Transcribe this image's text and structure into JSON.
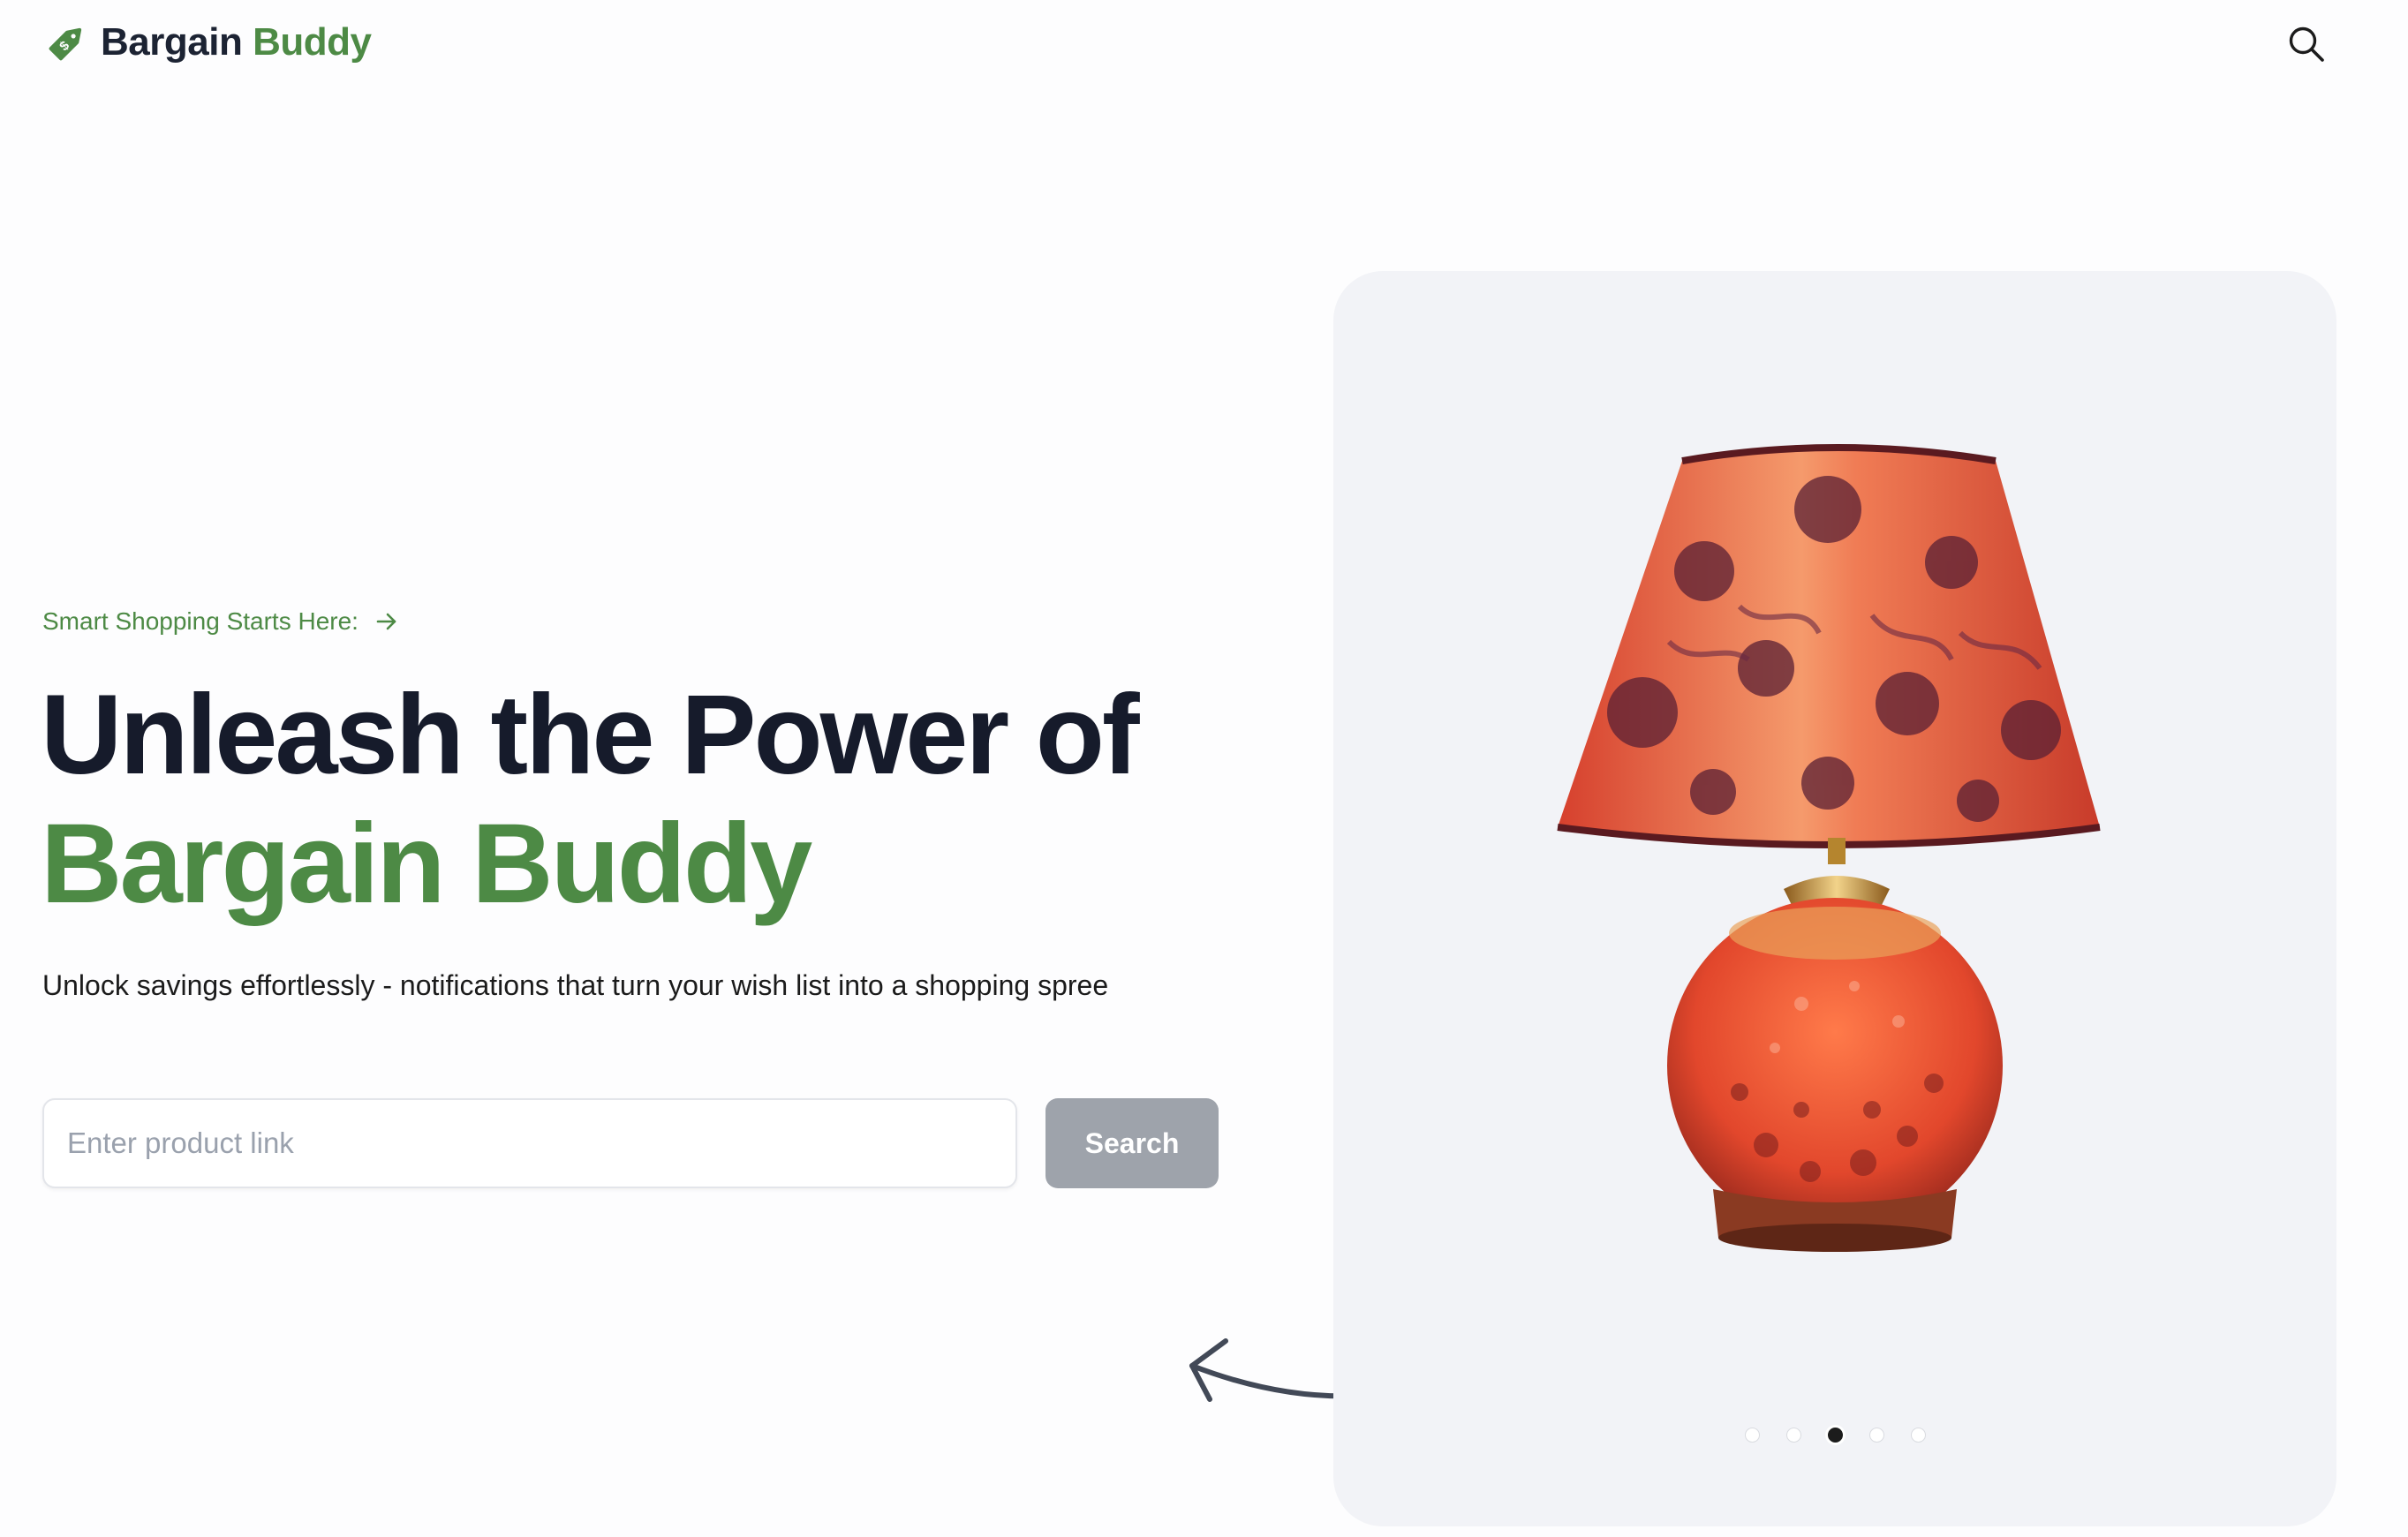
{
  "header": {
    "brand_first": "Bargain",
    "brand_second": "Buddy",
    "logo_icon": "price-tag-icon",
    "search_icon": "search-icon"
  },
  "hero": {
    "tagline": "Smart Shopping Starts Here:",
    "tagline_icon": "arrow-right-icon",
    "headline_line1": "Unleash the Power of",
    "headline_line2": "Bargain Buddy",
    "subtitle": "Unlock savings effortlessly - notifications that turn your wish list into a shopping spree",
    "search": {
      "placeholder": "Enter product link",
      "value": "",
      "button_label": "Search",
      "button_state": "disabled"
    }
  },
  "carousel": {
    "image": "table-lamp",
    "slide_count": 5,
    "active_index": 2
  },
  "colors": {
    "brand_green": "#4d8a45",
    "heading_dark": "#161b2b",
    "button_gray": "#9ea3ab",
    "panel_bg": "#f2f3f7"
  }
}
